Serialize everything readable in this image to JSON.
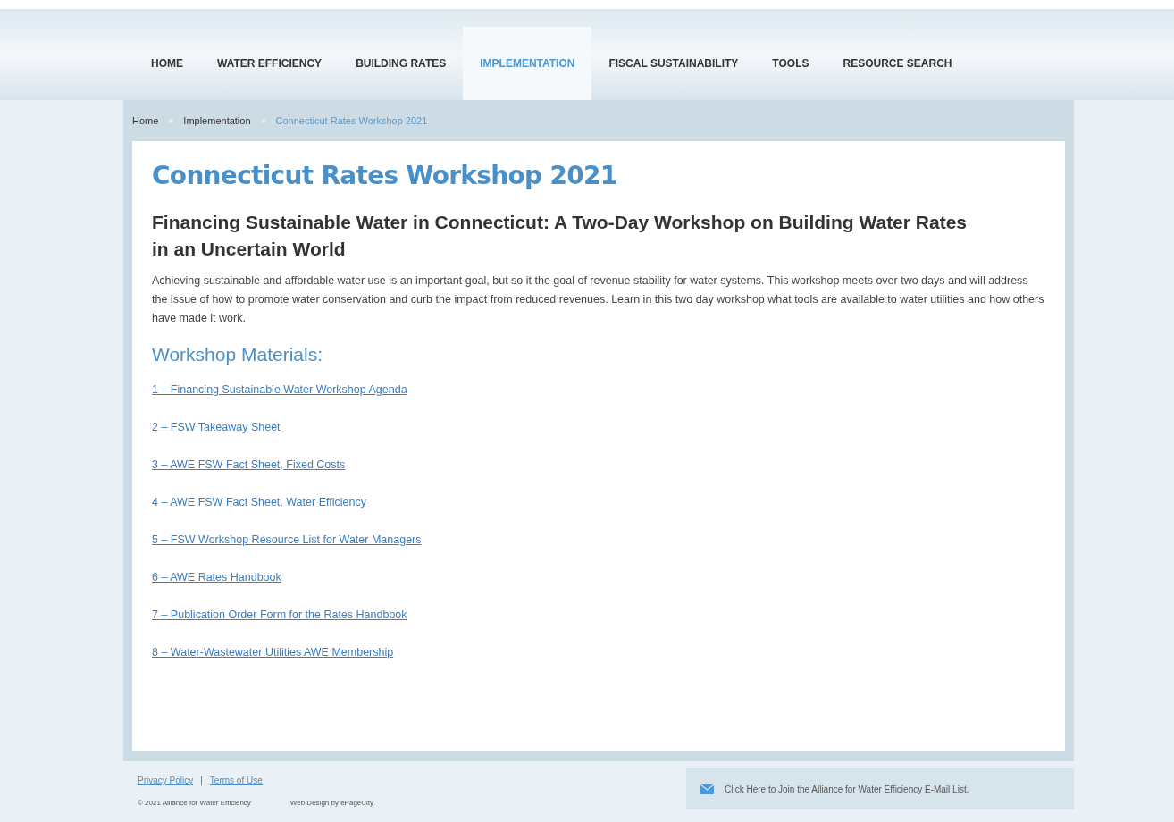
{
  "nav": [
    {
      "label": "HOME",
      "selected": false
    },
    {
      "label": "WATER EFFICIENCY",
      "selected": false
    },
    {
      "label": "BUILDING RATES",
      "selected": false
    },
    {
      "label": "IMPLEMENTATION",
      "selected": true
    },
    {
      "label": "FISCAL SUSTAINABILITY",
      "selected": false
    },
    {
      "label": "TOOLS",
      "selected": false
    },
    {
      "label": "RESOURCE SEARCH",
      "selected": false
    }
  ],
  "breadcrumb": [
    {
      "label": "Home",
      "current": false
    },
    {
      "label": "Implementation",
      "current": false
    },
    {
      "label": "Connecticut Rates Workshop 2021",
      "current": true
    }
  ],
  "title": "Connecticut Rates Workshop 2021",
  "subtitle": "Financing Sustainable Water in Connecticut:  A Two-Day Workshop on Building Water Rates in an Uncertain World",
  "intro": "Achieving sustainable and affordable water use is an important goal, but so it the goal of revenue stability for water systems. This workshop meets over two days and will address the issue of how to promote water conservation and curb the impact from reduced revenues. Learn in this two day workshop what tools are available to water utilities and how others have made it work.",
  "materials_heading": "Workshop Materials:",
  "materials": [
    "1 – Financing Sustainable Water Workshop Agenda",
    "2 – FSW Takeaway Sheet",
    "3 – AWE FSW Fact Sheet, Fixed Costs",
    "4 – AWE FSW Fact Sheet, Water Efficiency",
    "5 – FSW Workshop Resource List for Water Managers",
    "6 – AWE Rates Handbook",
    "7 – Publication Order Form for the Rates Handbook",
    "8 – Water-Wastewater Utilities AWE Membership"
  ],
  "footer": {
    "links": [
      "Privacy Policy",
      "Terms of Use"
    ],
    "separator": "|",
    "copyright": "© 2021 Alliance for Water Efficiency",
    "credit": "Web Design by ePageCity",
    "email_signup": "Click Here to Join the Alliance for Water Efficiency E-Mail List."
  }
}
